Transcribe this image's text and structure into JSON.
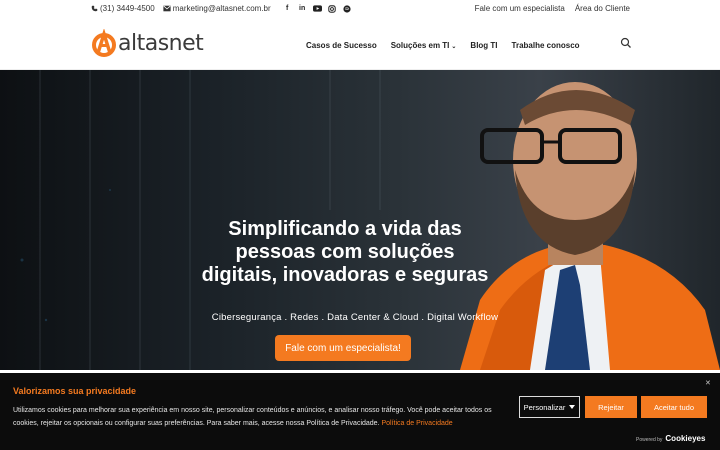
{
  "topbar": {
    "phone": "(31) 3449-4500",
    "email": "marketing@altasnet.com.br",
    "links": [
      "Fale com um especialista",
      "Área do Cliente"
    ]
  },
  "header": {
    "logo_text": "altasnet",
    "nav": [
      {
        "label": "Casos de Sucesso",
        "has_dropdown": false
      },
      {
        "label": "Soluções em TI",
        "has_dropdown": true
      },
      {
        "label": "Blog TI",
        "has_dropdown": false
      },
      {
        "label": "Trabalhe conosco",
        "has_dropdown": false
      }
    ]
  },
  "hero": {
    "title": "Simplificando a vida das pessoas com soluções digitais, inovadoras e seguras",
    "subtitle": "Cibersegurança . Redes . Data Center & Cloud . Digital Workflow",
    "cta": "Fale com um especialista!"
  },
  "cookie": {
    "title": "Valorizamos sua privacidade",
    "text": "Utilizamos cookies para melhorar sua experiência em nosso site, personalizar conteúdos e anúncios, e analisar nosso tráfego. Você pode aceitar todos os cookies, rejeitar os opcionais ou configurar suas preferências. Para saber mais, acesse nossa Política de Privacidade.",
    "policy_link": "Política de Privacidade",
    "customize": "Personalizar",
    "reject": "Rejeitar",
    "accept": "Aceitar tudo",
    "powered_by": "Powered by",
    "powered_brand": "Cookieyes"
  },
  "colors": {
    "accent": "#f47a20",
    "banner_bg": "#0c0c0c"
  }
}
